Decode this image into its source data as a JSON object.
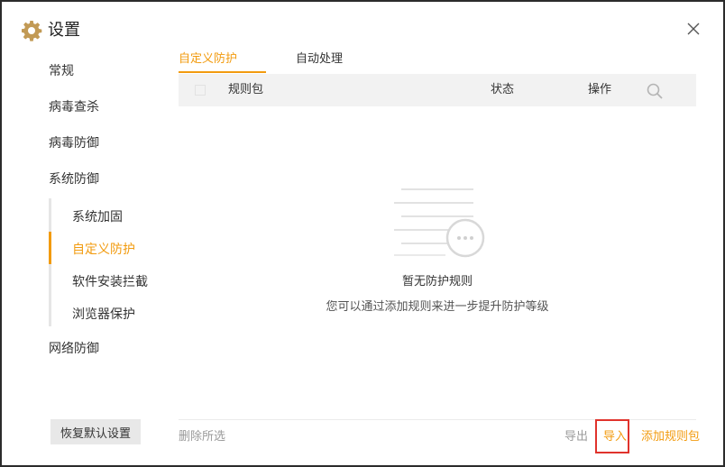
{
  "window": {
    "title": "设置",
    "close_label": ""
  },
  "sidebar": {
    "items": [
      {
        "label": "常规"
      },
      {
        "label": "病毒查杀"
      },
      {
        "label": "病毒防御"
      },
      {
        "label": "系统防御"
      },
      {
        "label": "网络防御"
      }
    ],
    "sub_items": [
      {
        "label": "系统加固",
        "active": false
      },
      {
        "label": "自定义防护",
        "active": true
      },
      {
        "label": "软件安装拦截",
        "active": false
      },
      {
        "label": "浏览器保护",
        "active": false
      }
    ],
    "reset_label": "恢复默认设置"
  },
  "tabs": [
    {
      "label": "自定义防护",
      "active": true
    },
    {
      "label": "自动处理",
      "active": false
    }
  ],
  "table": {
    "columns": [
      "规则包",
      "状态",
      "操作"
    ]
  },
  "empty": {
    "title": "暂无防护规则",
    "description": "您可以通过添加规则来进一步提升防护等级"
  },
  "footer": {
    "delete_selected": "删除所选",
    "export": "导出",
    "import": "导入",
    "add_rule_pack": "添加规则包"
  },
  "colors": {
    "accent": "#f29b0f",
    "highlight_box": "#e0332c"
  },
  "icons": {
    "title": "gear-icon",
    "close": "close-icon",
    "search": "search-icon"
  }
}
